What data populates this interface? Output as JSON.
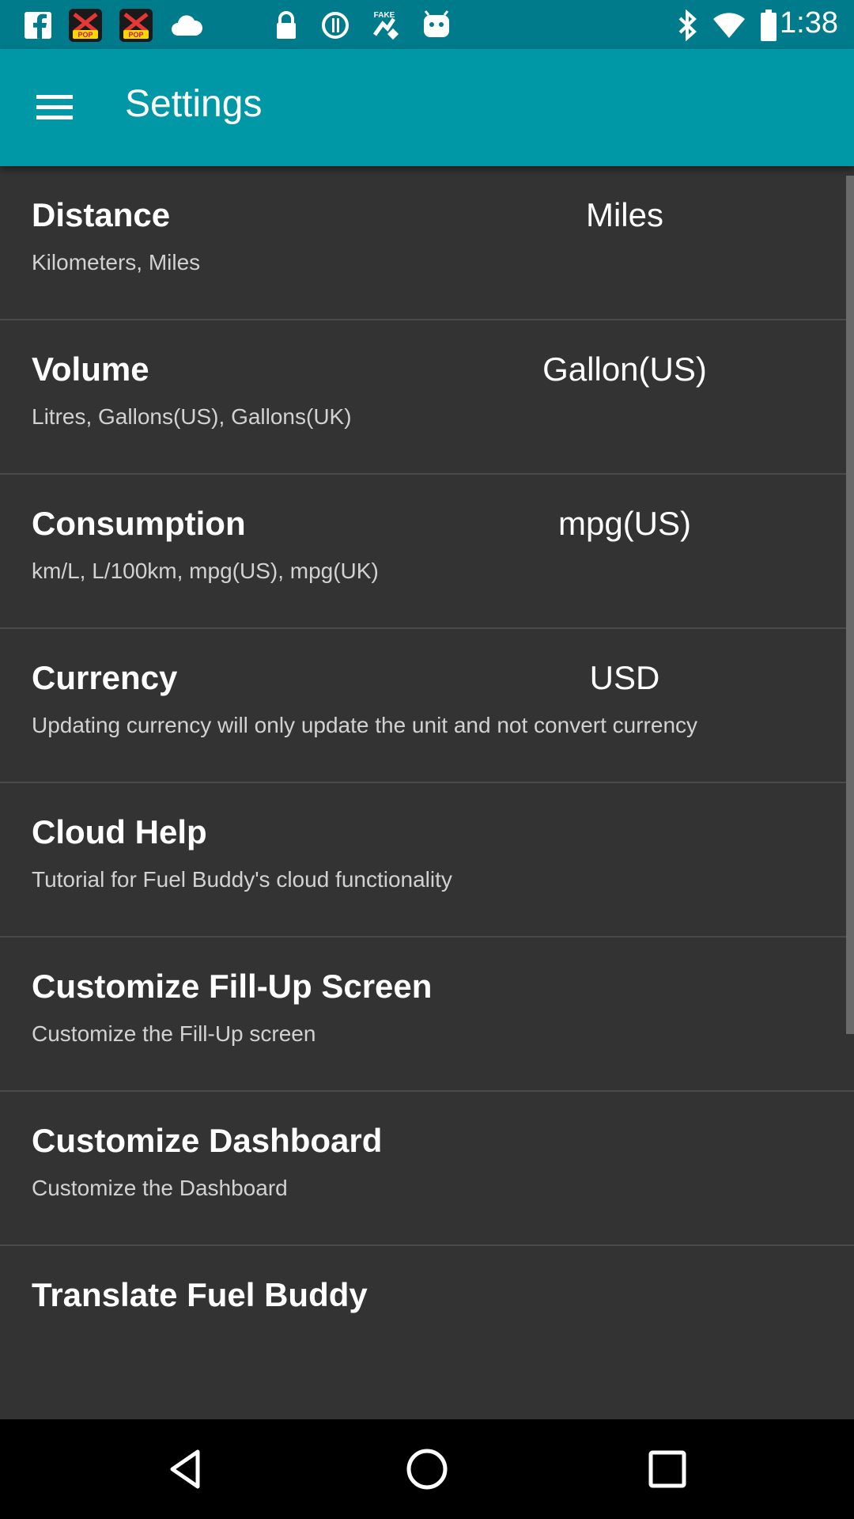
{
  "status_bar": {
    "time": "1:38",
    "icons": [
      "facebook-icon",
      "kpop-app-icon",
      "kpop-app-icon",
      "cloud-icon",
      "lock-icon",
      "sync-icon",
      "fake-gps-icon",
      "android-icon"
    ]
  },
  "header": {
    "title": "Settings",
    "menu_icon": "hamburger-menu-icon"
  },
  "settings": [
    {
      "title": "Distance",
      "subtitle": "Kilometers, Miles",
      "value": "Miles"
    },
    {
      "title": "Volume",
      "subtitle": "Litres, Gallons(US), Gallons(UK)",
      "value": "Gallon(US)"
    },
    {
      "title": "Consumption",
      "subtitle": "km/L, L/100km, mpg(US), mpg(UK)",
      "value": "mpg(US)"
    },
    {
      "title": "Currency",
      "subtitle": "Updating currency will only update the unit and not convert currency",
      "value": "USD"
    },
    {
      "title": "Cloud Help",
      "subtitle": "Tutorial for Fuel Buddy's cloud functionality"
    },
    {
      "title": "Customize Fill-Up Screen",
      "subtitle": "Customize the Fill-Up screen"
    },
    {
      "title": "Customize Dashboard",
      "subtitle": "Customize the Dashboard"
    },
    {
      "title": "Translate Fuel Buddy"
    }
  ],
  "nav_bar": {
    "buttons": [
      "back-icon",
      "home-icon",
      "recents-icon"
    ]
  },
  "colors": {
    "status_bar": "#007b8b",
    "app_bar": "#0097a7",
    "background": "#333333",
    "divider": "#4a4a4a",
    "nav_bar": "#000000"
  }
}
